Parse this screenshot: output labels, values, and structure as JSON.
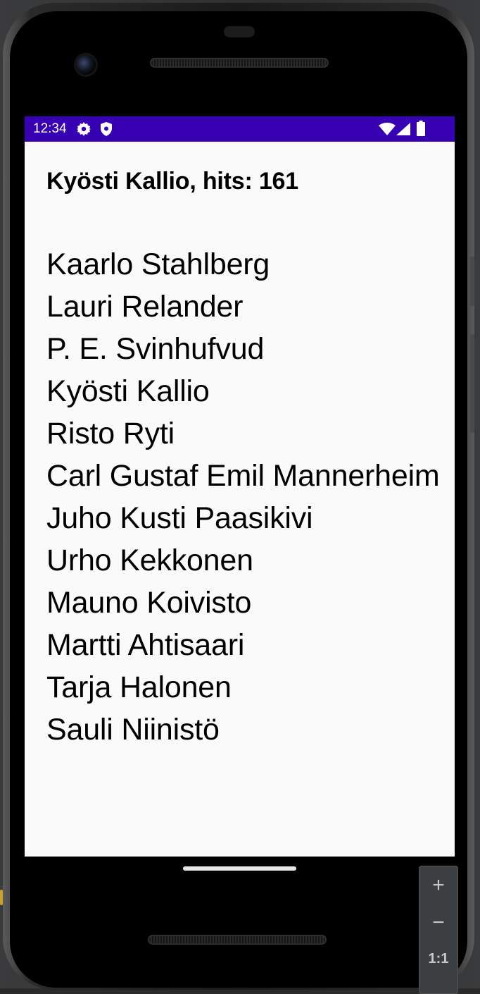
{
  "status_bar": {
    "time": "12:34",
    "left_icons": [
      "settings-icon",
      "shield-icon"
    ],
    "right_icons": [
      "wifi-icon",
      "signal-icon",
      "battery-icon"
    ],
    "color": "#3700b3"
  },
  "header": {
    "text": "Kyösti Kallio, hits: 161"
  },
  "names": [
    "Kaarlo Stahlberg",
    "Lauri Relander",
    "P. E. Svinhufvud",
    "Kyösti Kallio",
    "Risto Ryti",
    "Carl Gustaf Emil Mannerheim",
    "Juho Kusti Paasikivi",
    "Urho Kekkonen",
    "Mauno Koivisto",
    "Martti Ahtisaari",
    "Tarja Halonen",
    "Sauli Niinistö"
  ],
  "zoom_controls": {
    "zoom_in": "+",
    "zoom_out": "−",
    "actual_size": "1:1"
  }
}
